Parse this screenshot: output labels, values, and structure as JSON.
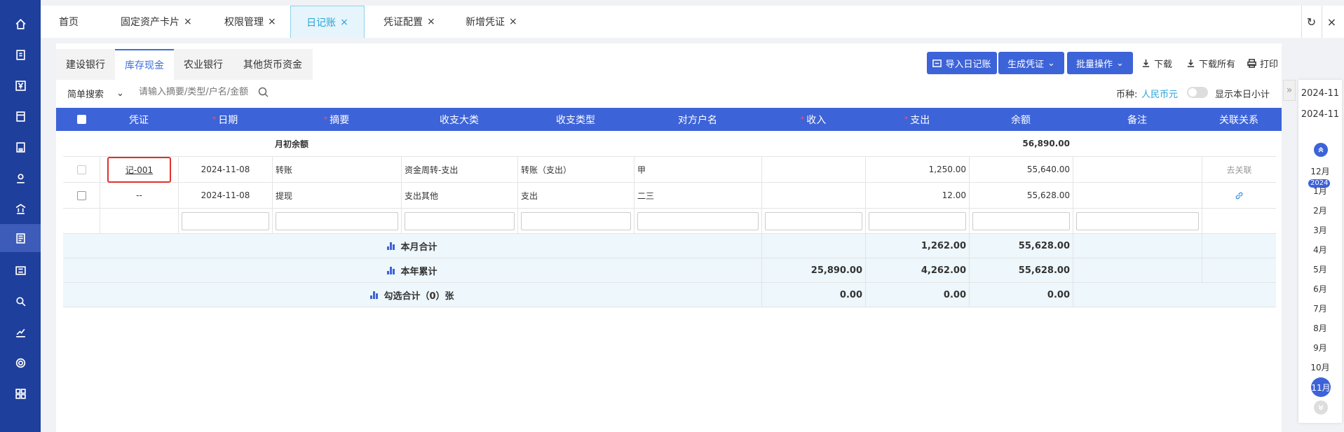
{
  "topTabs": [
    {
      "label": "首页",
      "closable": false
    },
    {
      "label": "固定资产卡片",
      "closable": true
    },
    {
      "label": "权限管理",
      "closable": true
    },
    {
      "label": "日记账",
      "closable": true,
      "active": true
    },
    {
      "label": "凭证配置",
      "closable": true
    },
    {
      "label": "新增凭证",
      "closable": true
    }
  ],
  "closeSymbol": "×",
  "subTabs": [
    "建设银行",
    "库存现金",
    "农业银行",
    "其他货币资金"
  ],
  "activeSubTab": "库存现金",
  "toolbar": {
    "import": "导入日记账",
    "generate": "生成凭证",
    "batch": "批量操作",
    "download": "下载",
    "downloadAll": "下载所有",
    "print": "打印"
  },
  "search": {
    "mode": "简单搜索",
    "placeholder": "请输入摘要/类型/户名/金额"
  },
  "currency": {
    "label": "币种:",
    "value": "人民币元"
  },
  "showDaily": "显示本日小计",
  "columns": [
    "凭证",
    "日期",
    "摘要",
    "收支大类",
    "收支类型",
    "对方户名",
    "收入",
    "支出",
    "余额",
    "备注",
    "关联关系"
  ],
  "opening": {
    "label": "月初余额",
    "balance": "56,890.00"
  },
  "rows": [
    {
      "voucher": "记-001",
      "date": "2024-11-08",
      "summary": "转账",
      "category": "资金周转-支出",
      "type": "转账（支出）",
      "party": "甲",
      "income": "",
      "expense": "1,250.00",
      "balance": "55,640.00",
      "note": "",
      "relation": "去关联"
    },
    {
      "voucher": "--",
      "date": "2024-11-08",
      "summary": "提现",
      "category": "支出其他",
      "type": "支出",
      "party": "二三",
      "income": "",
      "expense": "12.00",
      "balance": "55,628.00",
      "note": "",
      "relation": "link-icon"
    }
  ],
  "totals": [
    {
      "label": "本月合计",
      "income": "",
      "expense": "1,262.00",
      "balance": "55,628.00"
    },
    {
      "label": "本年累计",
      "income": "25,890.00",
      "expense": "4,262.00",
      "balance": "55,628.00"
    },
    {
      "label": "勾选合计（0）张",
      "income": "0.00",
      "expense": "0.00",
      "balance": "0.00"
    }
  ],
  "calendar": {
    "dates": [
      "2024-11",
      "2024-11"
    ],
    "year": "2024",
    "months": [
      "12月",
      "1月",
      "2月",
      "3月",
      "4月",
      "5月",
      "6月",
      "7月",
      "8月",
      "9月",
      "10月",
      "11月"
    ],
    "activeMonth": "11月"
  }
}
